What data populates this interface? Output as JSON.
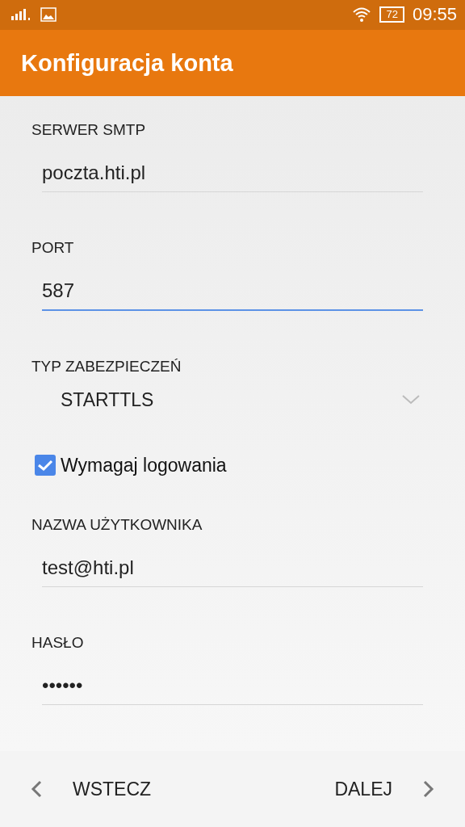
{
  "status_bar": {
    "time": "09:55",
    "battery": "72"
  },
  "app_bar": {
    "title": "Konfiguracja konta"
  },
  "form": [
    {
      "kind": "text",
      "label": "SERWER SMTP",
      "value": "poczta.hti.pl",
      "focused": false
    },
    {
      "kind": "text",
      "label": "PORT",
      "value": "587",
      "focused": true
    },
    {
      "kind": "select",
      "label": "TYP ZABEZPIECZEŃ",
      "value": "STARTTLS"
    },
    {
      "kind": "checkbox",
      "label": "Wymagaj logowania",
      "checked": true
    },
    {
      "kind": "text",
      "label": "NAZWA UŻYTKOWNIKA",
      "value": "test@hti.pl",
      "focused": false
    },
    {
      "kind": "text",
      "label": "HASŁO",
      "value": "••••••",
      "focused": false
    }
  ],
  "navigation": {
    "back": "WSTECZ",
    "next": "DALEJ"
  }
}
